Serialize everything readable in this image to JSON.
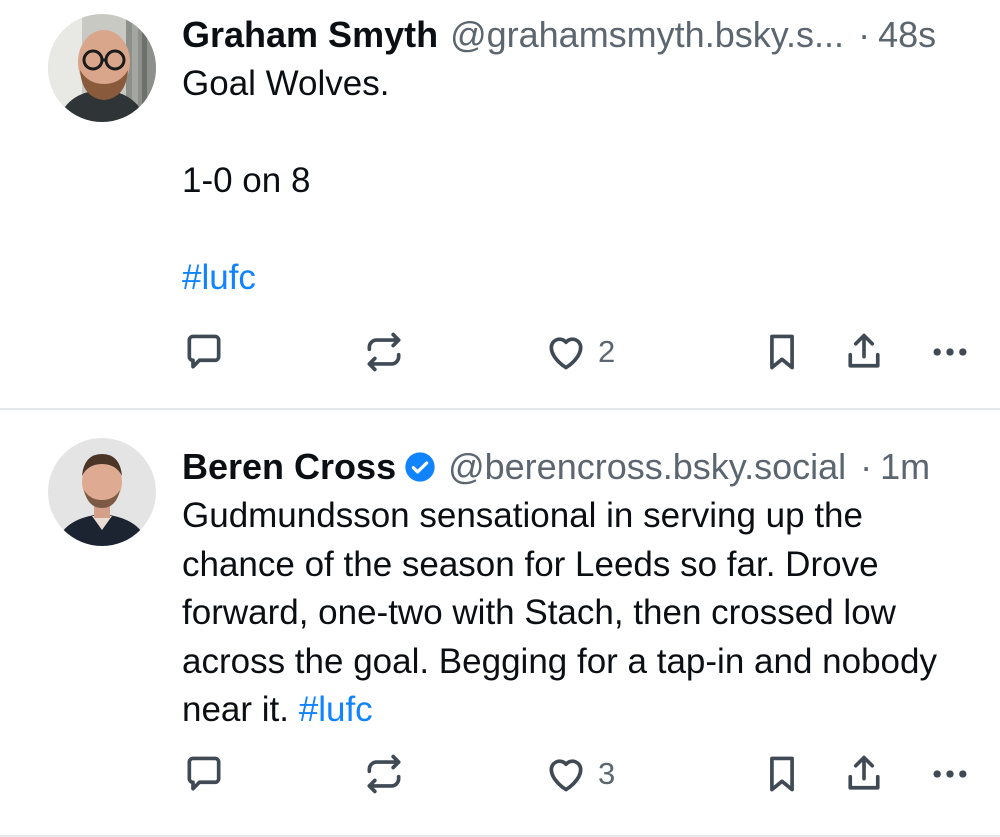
{
  "posts": [
    {
      "author_name": "Graham Smyth",
      "handle": "@grahamsmyth.bsky.s...",
      "separator": "·",
      "time": "48s",
      "text_plain": "Goal Wolves.\n\n1-0 on 8\n\n",
      "hashtag": "#lufc",
      "like_count": "2",
      "verified": false
    },
    {
      "author_name": "Beren Cross",
      "handle": "@berencross.bsky.social",
      "separator": "·",
      "time": "1m",
      "text_plain": "Gudmundsson sensational in serving up the chance of the season for Leeds so far. Drove forward, one-two with Stach, then crossed low across the goal. Begging for a tap-in and nobody near it. ",
      "hashtag": "#lufc",
      "like_count": "3",
      "verified": true
    }
  ],
  "colors": {
    "link": "#1083fe",
    "muted": "#5b6671",
    "icon": "#3f4a55",
    "verified_badge": "#1083fe"
  },
  "icons": [
    "reply-icon",
    "repost-icon",
    "like-icon",
    "bookmark-icon",
    "share-icon",
    "more-icon",
    "verified-icon"
  ]
}
